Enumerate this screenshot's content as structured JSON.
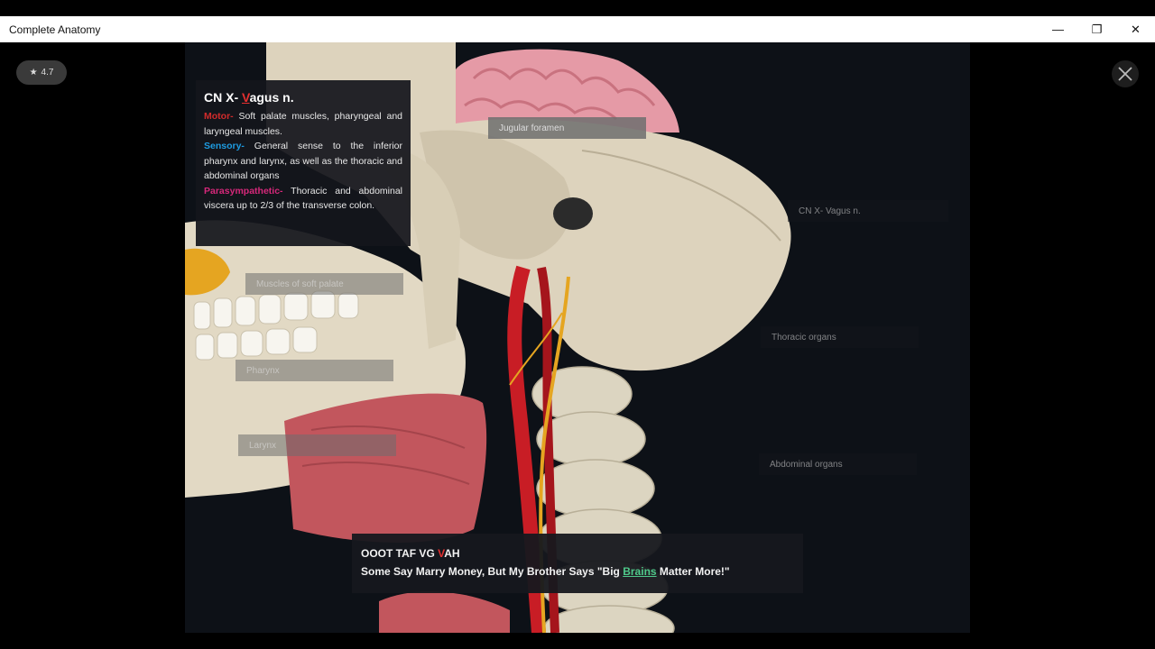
{
  "window": {
    "title": "Complete Anatomy",
    "controls": {
      "minimize": "—",
      "restore": "❐",
      "close": "✕"
    }
  },
  "rating": {
    "icon": "star-icon",
    "value": "4.7"
  },
  "info_card": {
    "title_prefix": "CN X- ",
    "title_accent": "V",
    "title_suffix": "agus n.",
    "motor_label": "Motor-",
    "motor_text": " Soft palate muscles, pharyngeal and laryngeal muscles.",
    "sensory_label": "Sensory-",
    "sensory_text": " General sense to the inferior pharynx and larynx, as well as the thoracic and abdominal organs",
    "para_label": "Parasympathetic-",
    "para_text": " Thoracic and abdominal viscera up to 2/3 of the transverse colon."
  },
  "labels": {
    "jugular": "Jugular foramen",
    "cn_x": "CN X- Vagus n.",
    "soft_palate": "Muscles of soft palate",
    "pharynx": "Pharynx",
    "thoracic": "Thoracic organs",
    "larynx": "Larynx",
    "abdominal": "Abdominal organs"
  },
  "mnemonic": {
    "line1_prefix": "OOOT TAF VG ",
    "line1_accent": "V",
    "line1_suffix": "AH",
    "line2_prefix": "Some Say Marry Money, But My Brother Says \"Big ",
    "line2_accent": "Brains",
    "line2_suffix": " Matter More!\""
  },
  "colors": {
    "motor": "#d22b2b",
    "sensory": "#1e9be0",
    "parasympathetic": "#d6287a",
    "highlight_green": "#4fc98a",
    "accent_red": "#e53030"
  }
}
